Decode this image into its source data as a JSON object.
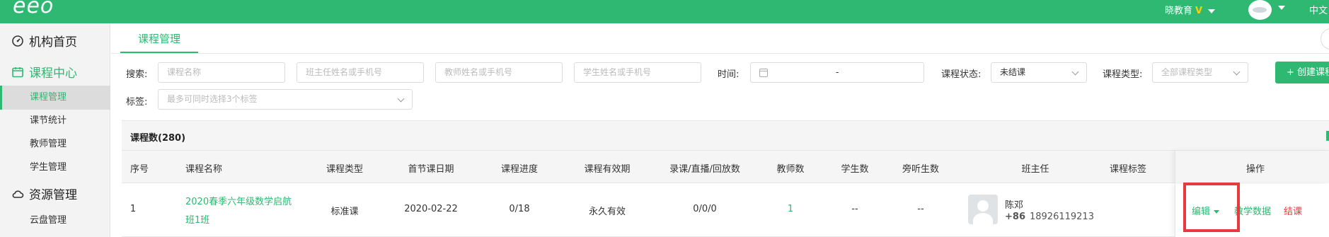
{
  "topbar": {
    "logo": "eeo",
    "org_name": "晓教育",
    "org_badge": "V",
    "language": "中文"
  },
  "sidebar": {
    "home": "机构首页",
    "course_center": "课程中心",
    "course_items": [
      {
        "label": "课程管理",
        "active": true
      },
      {
        "label": "课节统计",
        "active": false
      },
      {
        "label": "教师管理",
        "active": false
      },
      {
        "label": "学生管理",
        "active": false
      }
    ],
    "resource_manage": "资源管理",
    "resource_items": [
      {
        "label": "云盘管理"
      }
    ]
  },
  "tab": {
    "label": "课程管理"
  },
  "filters": {
    "search_label": "搜索:",
    "course_name_placeholder": "课程名称",
    "head_teacher_placeholder": "班主任姓名或手机号",
    "teacher_placeholder": "教师姓名或手机号",
    "student_placeholder": "学生姓名或手机号",
    "time_label": "时间:",
    "time_separator": "-",
    "status_label": "课程状态:",
    "status_value": "未结课",
    "type_label": "课程类型:",
    "type_placeholder": "全部课程类型",
    "tag_label": "标签:",
    "tag_placeholder": "最多可同时选择3个标签",
    "create_button": "+ 创建课程"
  },
  "table": {
    "count_label": "课程数(280)",
    "headers": [
      "序号",
      "课程名称",
      "课程类型",
      "首节课日期",
      "课程进度",
      "课程有效期",
      "录课/直播/回放数",
      "教师数",
      "学生数",
      "旁听生数",
      "班主任",
      "课程标签",
      "操作"
    ],
    "rows": [
      {
        "index": "1",
        "name": "2020春季六年级数学启航班1班",
        "type": "标准课",
        "first_date": "2020-02-22",
        "progress": "0/18",
        "validity": "永久有效",
        "record_live_replay": "0/0/0",
        "teacher_count": "1",
        "student_count": "--",
        "auditor_count": "--",
        "head_teacher_name": "陈邓",
        "head_teacher_country_code": "+86",
        "head_teacher_phone": "18926119213",
        "actions": {
          "edit": "编辑",
          "data": "教学数据",
          "end": "结课"
        }
      }
    ]
  },
  "colors": {
    "brand": "#2eb872",
    "danger": "#e8393f",
    "highlight_box": "#e8393f"
  }
}
